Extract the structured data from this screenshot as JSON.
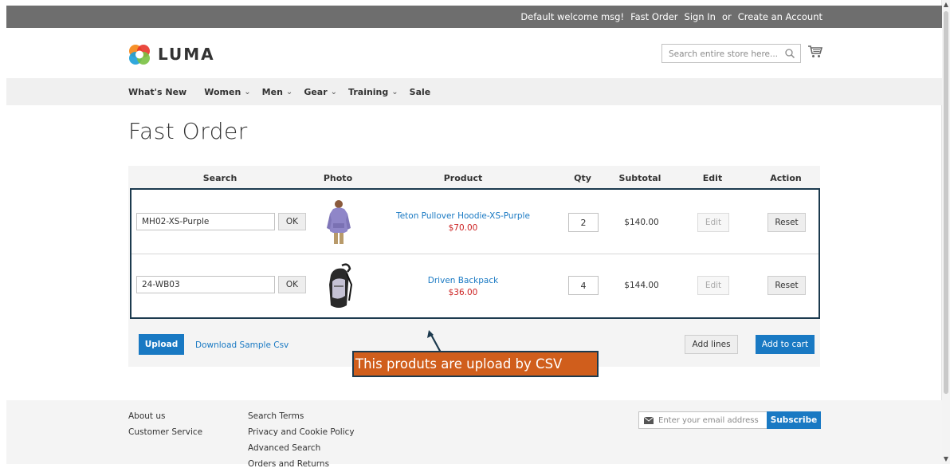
{
  "top_bar": {
    "welcome": "Default welcome msg!",
    "fast_order": "Fast Order",
    "sign_in": "Sign In",
    "or": "or",
    "create_account": "Create an Account"
  },
  "header": {
    "logo_text": "LUMA",
    "search_placeholder": "Search entire store here..."
  },
  "nav": {
    "items": [
      {
        "label": "What's New",
        "has_submenu": false
      },
      {
        "label": "Women",
        "has_submenu": true
      },
      {
        "label": "Men",
        "has_submenu": true
      },
      {
        "label": "Gear",
        "has_submenu": true
      },
      {
        "label": "Training",
        "has_submenu": true
      },
      {
        "label": "Sale",
        "has_submenu": false
      }
    ]
  },
  "page": {
    "title": "Fast Order"
  },
  "table": {
    "headers": [
      "Search",
      "Photo",
      "Product",
      "Qty",
      "Subtotal",
      "Edit",
      "Action"
    ],
    "rows": [
      {
        "sku": "MH02-XS-Purple",
        "ok_label": "OK",
        "photo": "hoodie-photo",
        "product_name": "Teton Pullover Hoodie-XS-Purple",
        "price": "$70.00",
        "qty": "2",
        "subtotal": "$140.00",
        "edit_label": "Edit",
        "action_label": "Reset"
      },
      {
        "sku": "24-WB03",
        "ok_label": "OK",
        "photo": "backpack-photo",
        "product_name": "Driven Backpack",
        "price": "$36.00",
        "qty": "4",
        "subtotal": "$144.00",
        "edit_label": "Edit",
        "action_label": "Reset"
      }
    ]
  },
  "actions": {
    "upload": "Upload",
    "download_sample": "Download Sample Csv",
    "add_lines": "Add lines",
    "add_to_cart": "Add to cart"
  },
  "annotation": {
    "callout_text": "This produts are upload by CSV"
  },
  "footer": {
    "col1": [
      "About us",
      "Customer Service"
    ],
    "col2": [
      "Search Terms",
      "Privacy and Cookie Policy",
      "Advanced Search",
      "Orders and Returns"
    ],
    "newsletter_placeholder": "Enter your email address",
    "subscribe": "Subscribe"
  },
  "colors": {
    "accent_blue": "#1979c3",
    "price_red": "#cc2222",
    "top_bar": "#6e6e6e",
    "callout_bg": "#d05e1c",
    "callout_border": "#1c3a4e"
  }
}
